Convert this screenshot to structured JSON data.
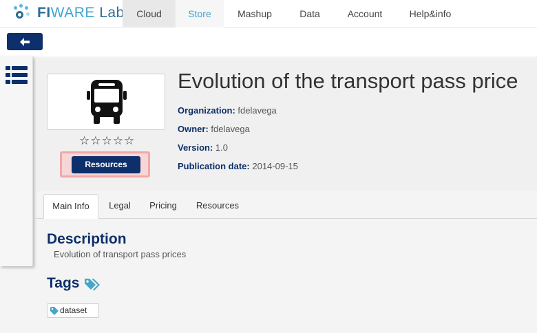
{
  "brand": {
    "name_part1": "FI",
    "name_part2": "WARE",
    "name_part3": " Lab"
  },
  "nav": {
    "items": [
      {
        "label": "Cloud"
      },
      {
        "label": "Store"
      },
      {
        "label": "Mashup"
      },
      {
        "label": "Data"
      },
      {
        "label": "Account"
      },
      {
        "label": "Help&info"
      }
    ],
    "active": "Store"
  },
  "offering": {
    "title": "Evolution of the transport pass price",
    "icon": "bus-icon",
    "rating_stars_total": 5,
    "rating_value": 0,
    "resources_button": "Resources",
    "meta": [
      {
        "key": "Organization:",
        "value": "fdelavega"
      },
      {
        "key": "Owner:",
        "value": "fdelavega"
      },
      {
        "key": "Version:",
        "value": "1.0"
      },
      {
        "key": "Publication date:",
        "value": "2014-09-15"
      }
    ]
  },
  "tabs": [
    {
      "label": "Main Info"
    },
    {
      "label": "Legal"
    },
    {
      "label": "Pricing"
    },
    {
      "label": "Resources"
    }
  ],
  "active_tab": "Main Info",
  "main": {
    "description_heading": "Description",
    "description_text": "Evolution of transport pass prices",
    "tags_heading": "Tags",
    "tags": [
      {
        "label": "dataset"
      }
    ]
  },
  "colors": {
    "navy": "#0d2f6b",
    "accent": "#3fa4cf",
    "highlight": "#f1a7a7",
    "tag": "#4aa5c7"
  }
}
